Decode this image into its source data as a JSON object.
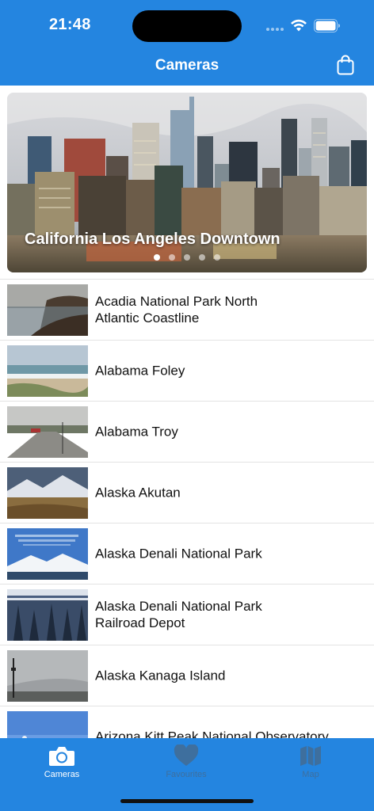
{
  "status_bar": {
    "time": "21:48"
  },
  "nav": {
    "title": "Cameras"
  },
  "hero": {
    "title": "California Los Angeles Downtown",
    "page_count": 5,
    "active_page": 1
  },
  "cameras": [
    {
      "label": "Acadia National Park North\nAtlantic Coastline",
      "thumb": "coast-rocks"
    },
    {
      "label": "Alabama Foley",
      "thumb": "beach"
    },
    {
      "label": "Alabama Troy",
      "thumb": "road"
    },
    {
      "label": "Alaska Akutan",
      "thumb": "mountains"
    },
    {
      "label": "Alaska Denali National Park",
      "thumb": "denali"
    },
    {
      "label": "Alaska Denali National Park\nRailroad Depot",
      "thumb": "snow-forest"
    },
    {
      "label": "Alaska Kanaga Island",
      "thumb": "gray-sky"
    },
    {
      "label": "Arizona Kitt Peak National Observatory",
      "thumb": "blue-sky"
    }
  ],
  "tabs": [
    {
      "label": "Cameras",
      "icon": "camera-icon",
      "active": true
    },
    {
      "label": "Favourites",
      "icon": "heart-icon",
      "active": false
    },
    {
      "label": "Map",
      "icon": "map-icon",
      "active": false
    }
  ],
  "colors": {
    "accent": "#2485e0",
    "tab_inactive": "#3e6f9e"
  }
}
